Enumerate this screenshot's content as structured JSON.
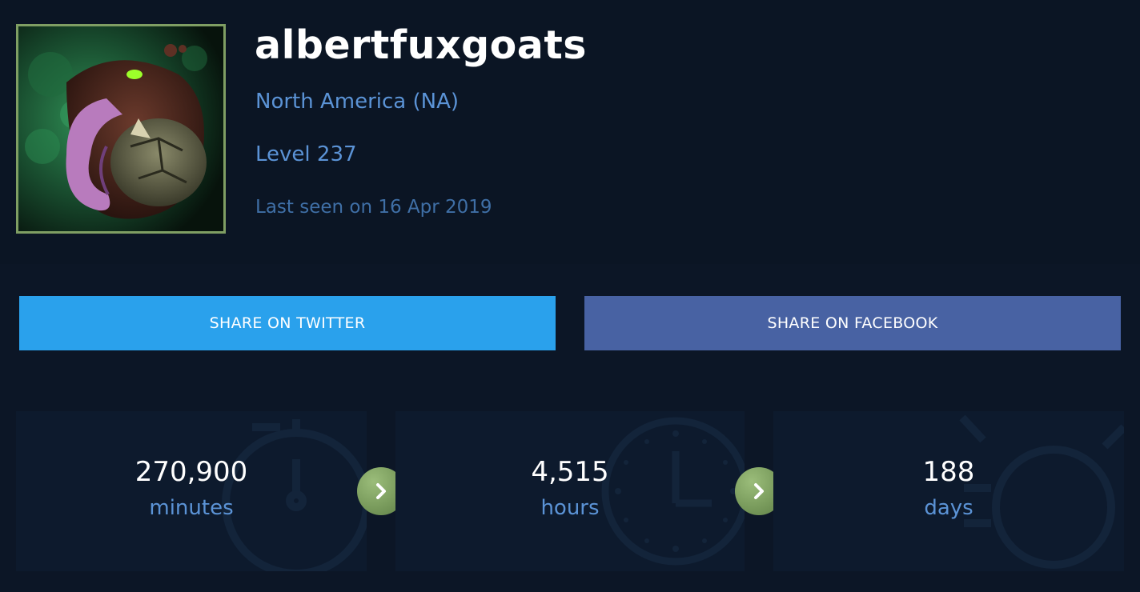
{
  "profile": {
    "username": "albertfuxgoats",
    "region": "North America (NA)",
    "level": "Level 237",
    "last_seen": "Last seen on 16 Apr 2019",
    "avatar_icon": "champion-portrait-icon"
  },
  "share": {
    "twitter_label": "SHARE ON TWITTER",
    "facebook_label": "SHARE ON FACEBOOK"
  },
  "stats": [
    {
      "value": "270,900",
      "unit": "minutes",
      "icon": "stopwatch-icon"
    },
    {
      "value": "4,515",
      "unit": "hours",
      "icon": "clock-icon"
    },
    {
      "value": "188",
      "unit": "days",
      "icon": "timer-icon"
    }
  ],
  "colors": {
    "background": "#0c1626",
    "twitter": "#2aa1ec",
    "facebook": "#4862a3",
    "accent_green": "#7f9e63",
    "text_blue": "#5b93d6"
  }
}
